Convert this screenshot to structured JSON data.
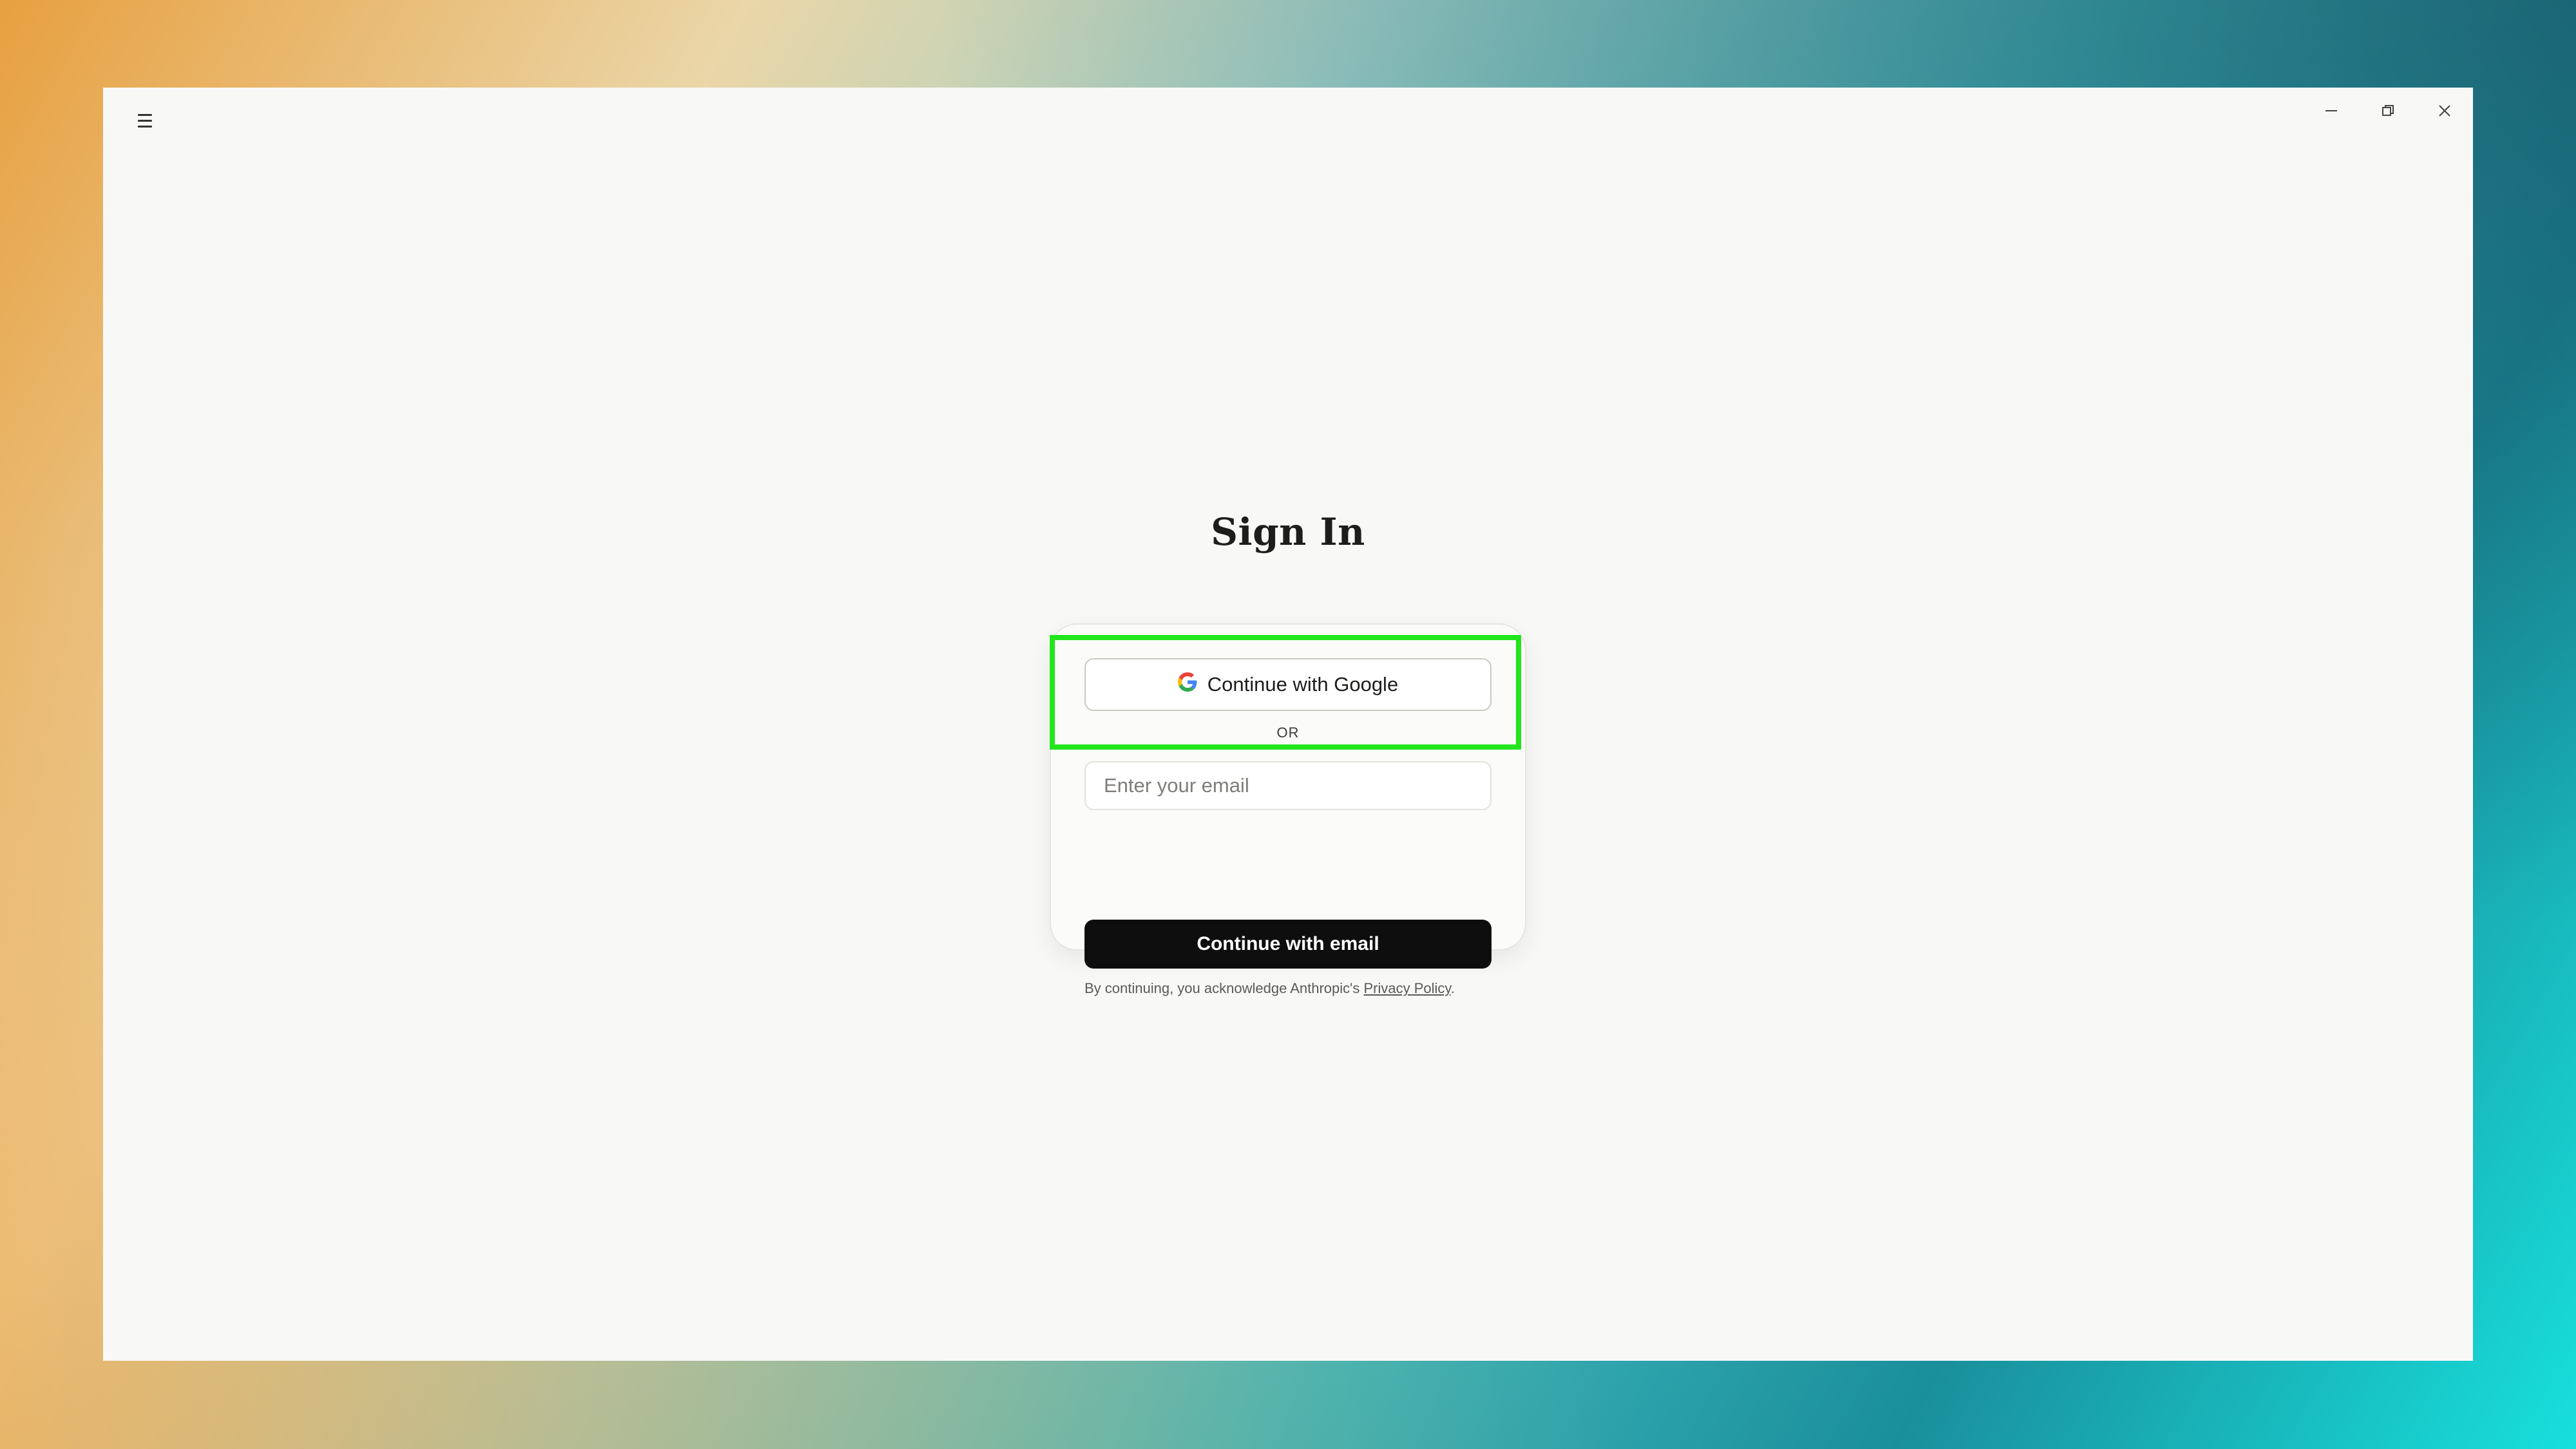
{
  "window": {
    "menu_icon": "hamburger-menu-icon",
    "controls": {
      "minimize_icon": "minimize-icon",
      "restore_icon": "restore-icon",
      "close_icon": "close-icon"
    }
  },
  "signin": {
    "title": "Sign In",
    "google_button_label": "Continue with Google",
    "google_icon": "google-g-icon",
    "divider_text": "OR",
    "email_placeholder": "Enter your email",
    "email_value": "",
    "email_button_label": "Continue with email",
    "legal_text": "By continuing, you acknowledge Anthropic's ",
    "privacy_link": "Privacy Policy",
    "legal_suffix": "."
  },
  "colors": {
    "highlight": "#22e51c",
    "primary_button": "#0e0e0e",
    "background": "#f8f8f7"
  }
}
